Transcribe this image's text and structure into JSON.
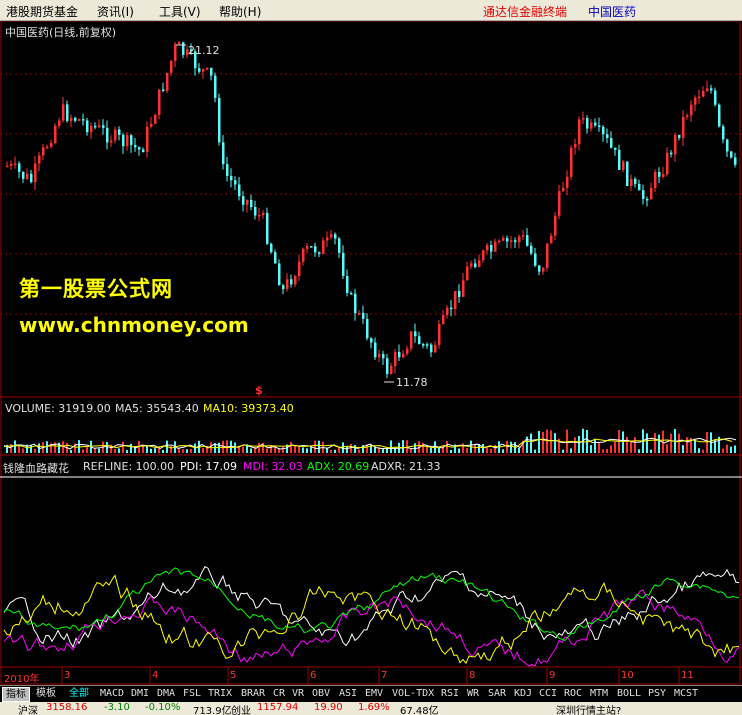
{
  "menu": {
    "items": [
      "港股期货基金",
      "资讯(I)",
      "工具(V)",
      "帮助(H)"
    ],
    "app_title": "通达信金融终端",
    "stock_name": "中国医药"
  },
  "price_pane": {
    "title": "中国医药(日线,前复权)",
    "high_label": "21.12",
    "low_label": "11.78",
    "marker": "$"
  },
  "watermark": {
    "line1": "第一股票公式网",
    "line2": "www.chnmoney.com"
  },
  "volume_pane": {
    "volume": "VOLUME: 31919.00",
    "ma5": "MA5: 35543.40",
    "ma10": "MA10: 39373.40"
  },
  "indicator_pane": {
    "name": "钱隆血路藏花",
    "refline": "REFLINE: 100.00",
    "pdi": "PDI: 17.09",
    "mdi": "MDI: 32.03",
    "adx": "ADX: 20.69",
    "adxr": "ADXR: 21.33"
  },
  "time_axis": {
    "labels": [
      "2010年",
      "3",
      "4",
      "5",
      "6",
      "7",
      "8",
      "9",
      "10",
      "11"
    ]
  },
  "tabs": {
    "items": [
      "指标",
      "模板",
      "全部",
      "MACD",
      "DMI",
      "DMA",
      "FSL",
      "TRIX",
      "BRAR",
      "CR",
      "VR",
      "OBV",
      "ASI",
      "EMV",
      "VOL-TDX",
      "RSI",
      "WR",
      "SAR",
      "KDJ",
      "CCI",
      "ROC",
      "MTM",
      "BOLL",
      "PSY",
      "MCST"
    ]
  },
  "status": {
    "sh_label": "沪深",
    "sh_index": "3158.16",
    "sh_change": "-3.10",
    "sh_pct": "-0.10%",
    "sh_amount": "713.9亿",
    "sz_label": "创业",
    "sz_index": "1157.94",
    "sz_change": "19.90",
    "sz_pct": "1.69%",
    "sz_amount": "67.48亿",
    "hint": "深圳行情主站?"
  },
  "colors": {
    "up": "#ff3232",
    "down": "#54fcfc",
    "pdi": "#ffffff",
    "mdi": "#ff00ff",
    "adx": "#00ff00",
    "adxr": "#ffff00"
  }
}
